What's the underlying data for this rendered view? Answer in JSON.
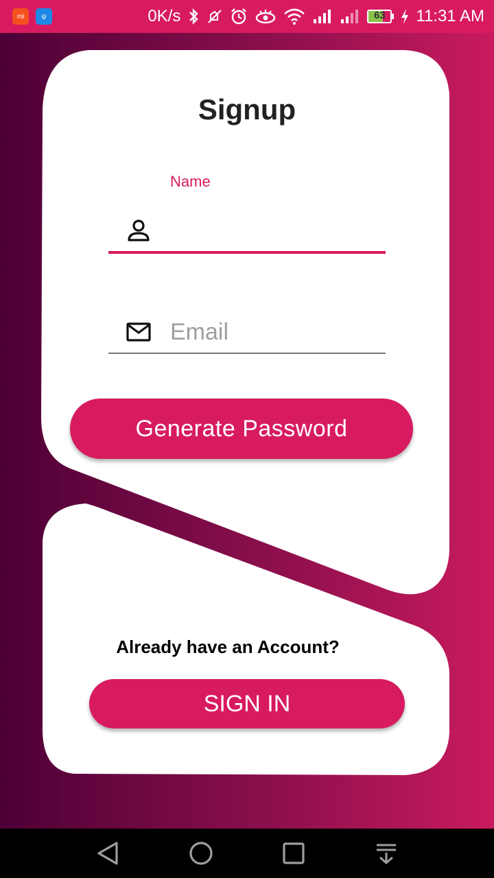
{
  "status_bar": {
    "net_speed": "0K/s",
    "battery_level": "63",
    "battery_fraction": 0.63,
    "time": "11:31 AM",
    "left_icons": [
      "mi-app-icon",
      "usb-icon"
    ],
    "right_icons": [
      "bluetooth-icon",
      "mute-icon",
      "alarm-icon",
      "eye-care-icon",
      "wifi-icon",
      "signal-icon",
      "signal-icon",
      "battery-icon",
      "charging-icon"
    ]
  },
  "signup": {
    "title": "Signup",
    "name_field": {
      "label": "Name",
      "value": "",
      "icon": "person-icon"
    },
    "email_field": {
      "placeholder": "Email",
      "value": "",
      "icon": "mail-icon"
    },
    "generate_button": "Generate Password"
  },
  "signin": {
    "prompt": "Already have an Account?",
    "button": "SIGN IN"
  },
  "nav_bar": {
    "buttons": [
      "back-icon",
      "home-icon",
      "recents-icon",
      "notification-drawer-icon"
    ]
  },
  "colors": {
    "accent": "#d81b60",
    "gradient_start": "#4d0036",
    "gradient_end": "#c91b5e",
    "card": "#ffffff"
  }
}
